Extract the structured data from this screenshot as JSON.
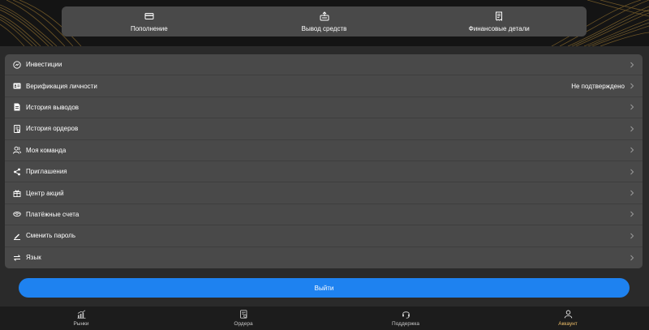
{
  "top_actions": [
    {
      "label": "Пополнение",
      "icon": "card-icon"
    },
    {
      "label": "Вывод средств",
      "icon": "withdraw-icon"
    },
    {
      "label": "Финансовые детали",
      "icon": "receipt-icon"
    }
  ],
  "menu": [
    {
      "label": "Инвестиции",
      "icon": "investment-icon",
      "value": ""
    },
    {
      "label": "Верификация личности",
      "icon": "id-card-icon",
      "value": "Не подтверждено"
    },
    {
      "label": "История выводов",
      "icon": "withdraw-history-icon",
      "value": ""
    },
    {
      "label": "История ордеров",
      "icon": "order-history-icon",
      "value": ""
    },
    {
      "label": "Моя команда",
      "icon": "team-icon",
      "value": ""
    },
    {
      "label": "Приглашения",
      "icon": "share-icon",
      "value": ""
    },
    {
      "label": "Центр акций",
      "icon": "gift-icon",
      "value": ""
    },
    {
      "label": "Платёжные счета",
      "icon": "payment-accounts-icon",
      "value": ""
    },
    {
      "label": "Сменить пароль",
      "icon": "pen-icon",
      "value": ""
    },
    {
      "label": "Язык",
      "icon": "swap-icon",
      "value": ""
    }
  ],
  "logout_label": "Выйти",
  "bottom_nav": [
    {
      "label": "Рынки",
      "icon": "chart-bars-icon",
      "active": false
    },
    {
      "label": "Ордера",
      "icon": "orders-icon",
      "active": false
    },
    {
      "label": "Поддержка",
      "icon": "headset-icon",
      "active": false
    },
    {
      "label": "Аккаунт",
      "icon": "user-icon",
      "active": true
    }
  ],
  "colors": {
    "accent": "#1e82f0",
    "active_nav": "#f3c26a",
    "card": "#494949",
    "background": "#2a2a2a"
  }
}
